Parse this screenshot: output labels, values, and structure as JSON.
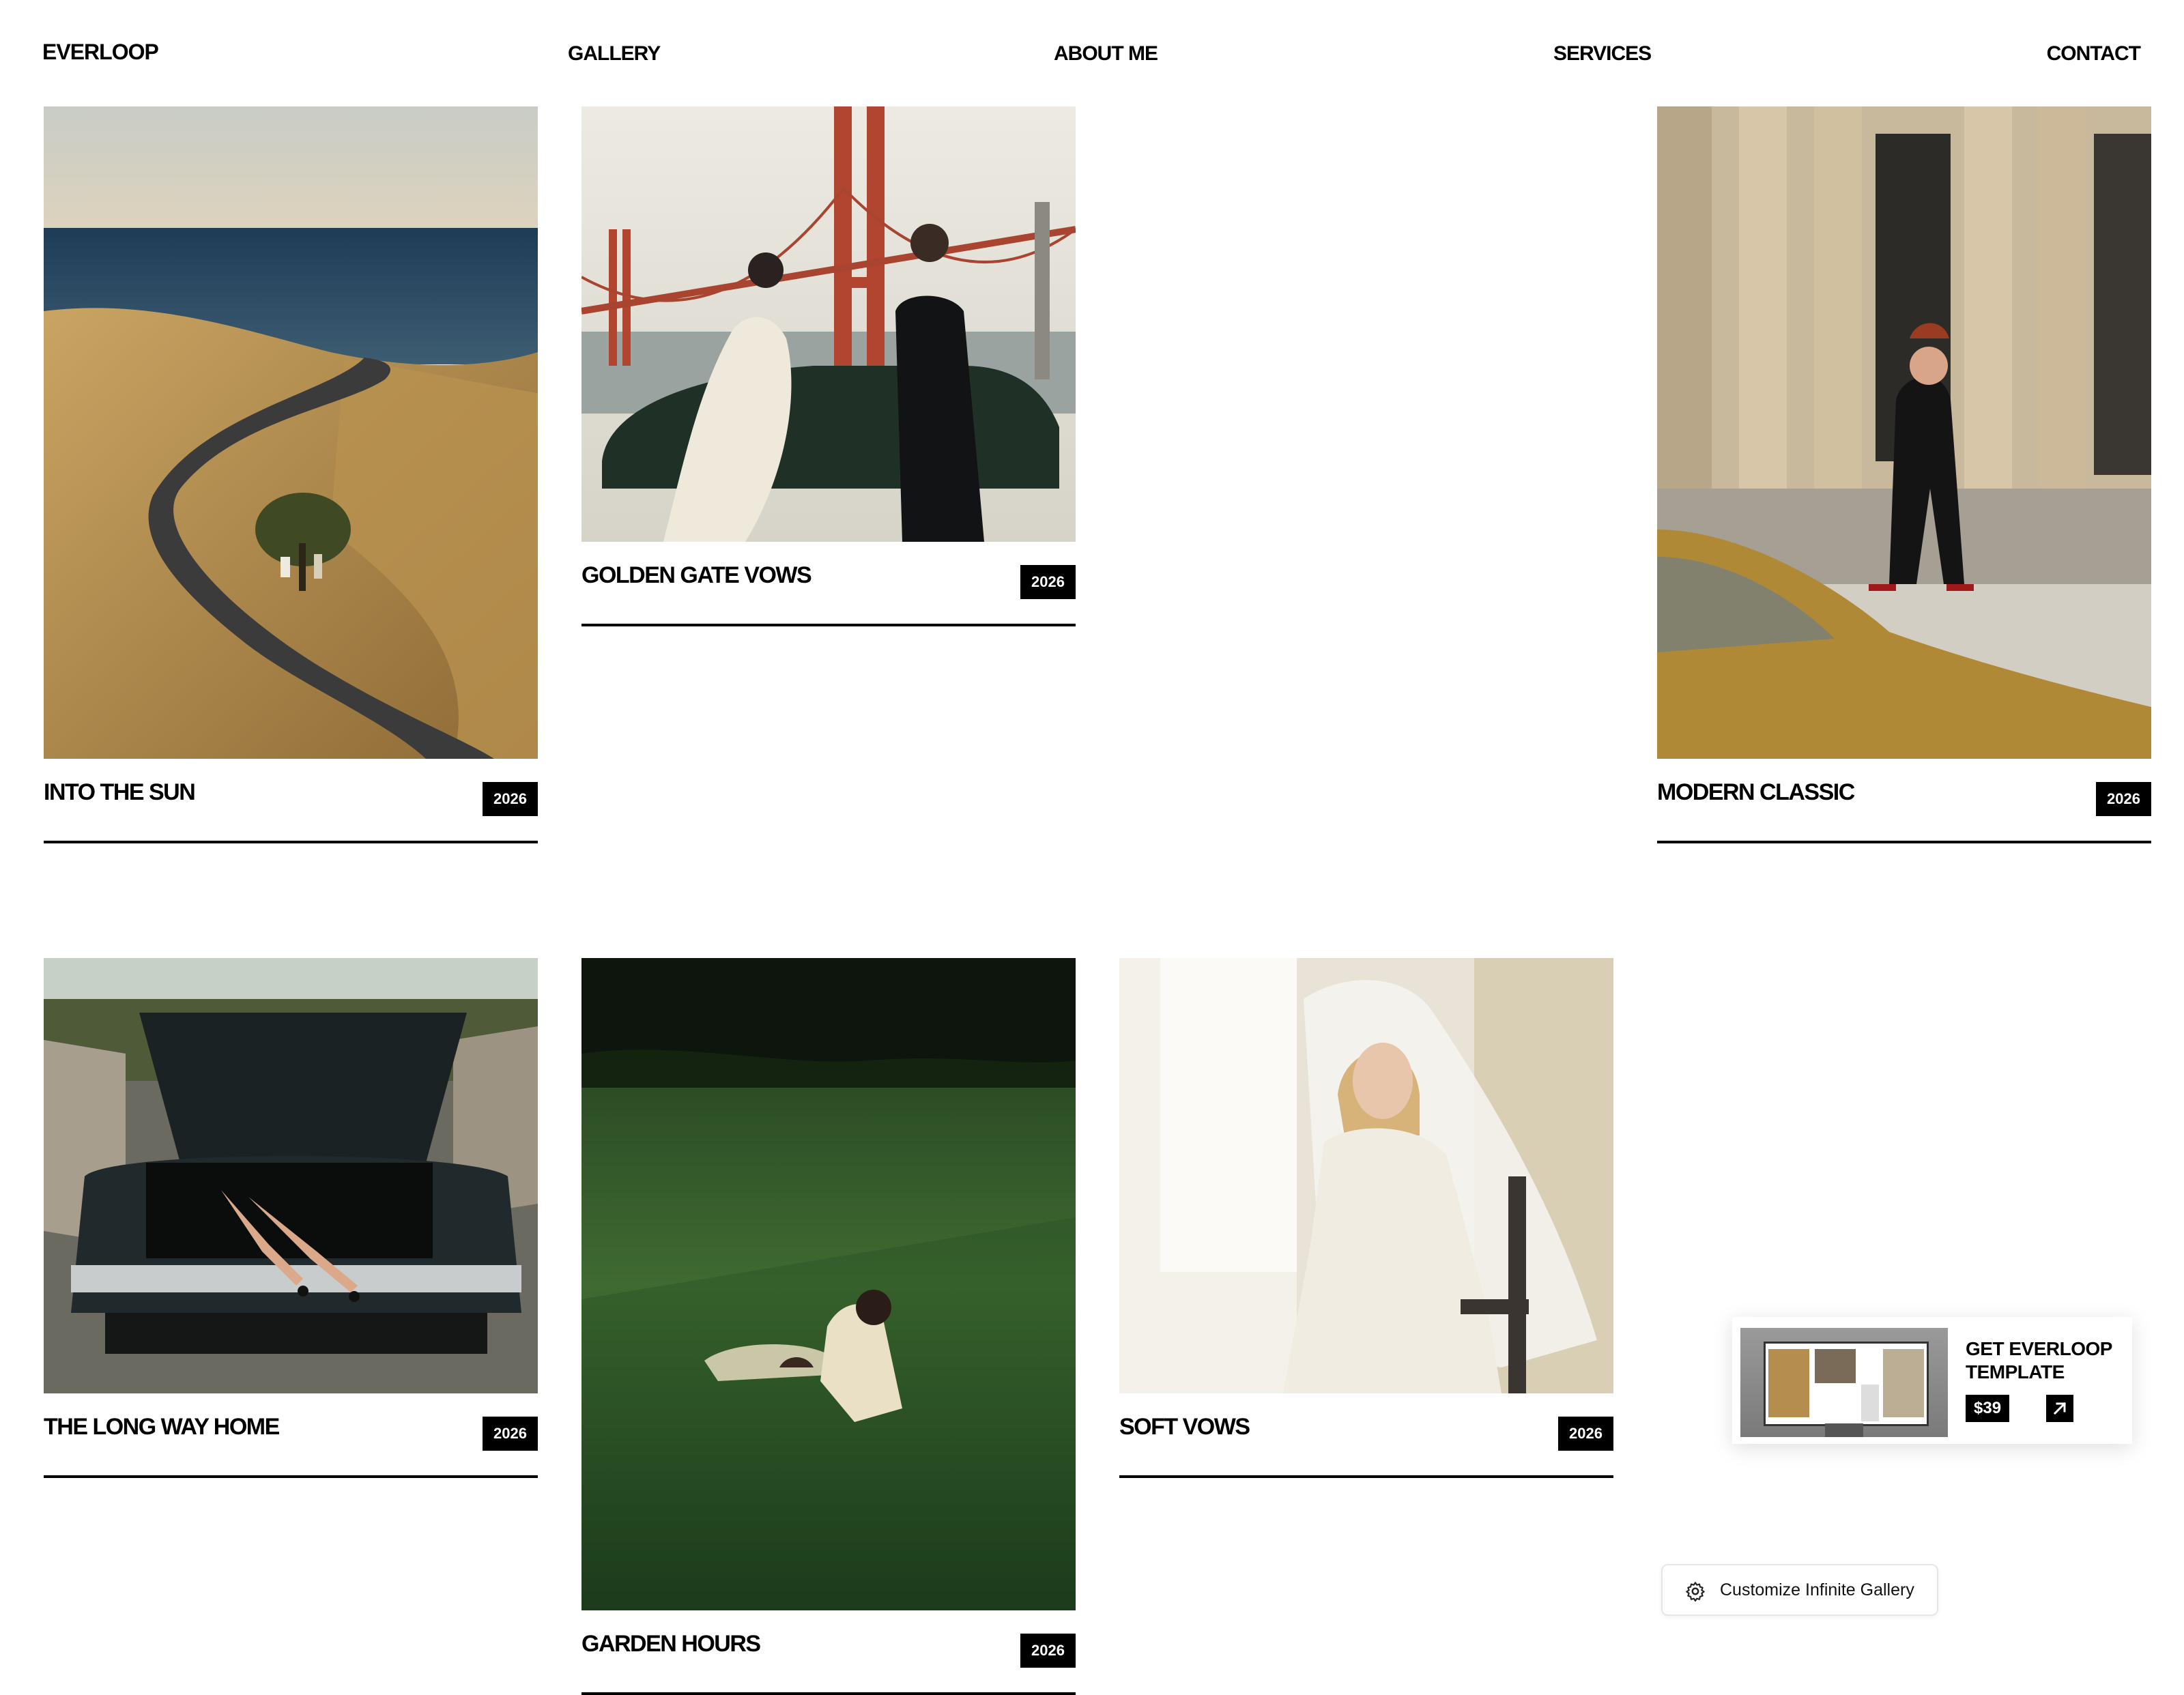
{
  "nav": {
    "logo": "EVERLOOP",
    "links": [
      "GALLERY",
      "ABOUT ME",
      "SERVICES",
      "CONTACT"
    ]
  },
  "cards": [
    {
      "title": "INTO THE SUN",
      "year": "2026"
    },
    {
      "title": "GOLDEN GATE VOWS",
      "year": "2026"
    },
    {
      "title": "MODERN CLASSIC",
      "year": "2026"
    },
    {
      "title": "THE LONG WAY HOME",
      "year": "2026"
    },
    {
      "title": "GARDEN HOURS",
      "year": "2026"
    },
    {
      "title": "SOFT VOWS",
      "year": "2026"
    }
  ],
  "promo": {
    "title": "GET EVERLOOP TEMPLATE",
    "price": "$39",
    "arrow_icon": "arrow-up-right-icon"
  },
  "customize": {
    "label": "Customize Infinite Gallery",
    "icon": "gear-icon"
  }
}
